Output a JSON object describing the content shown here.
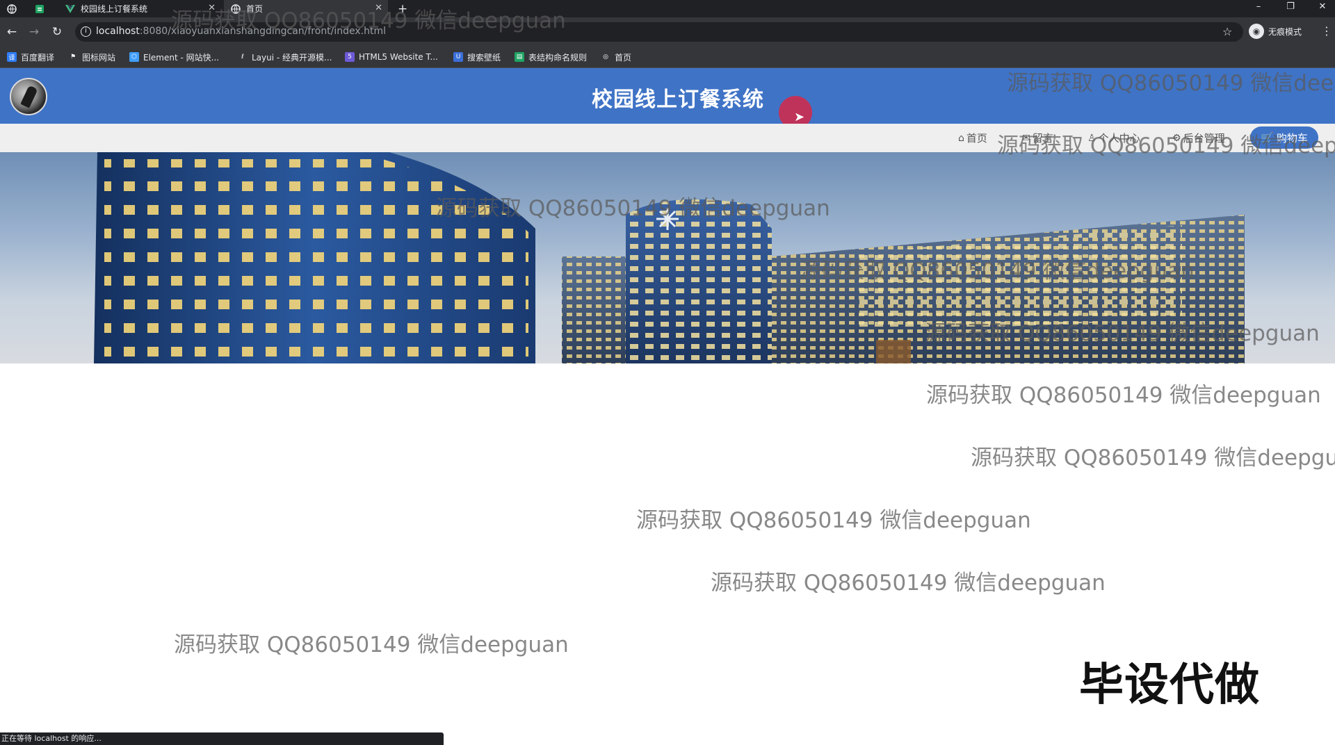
{
  "browser": {
    "tabs": [
      {
        "title": "",
        "icon": "globe-icon"
      },
      {
        "title": "",
        "icon": "green-square-icon"
      },
      {
        "title": "校园线上订餐系统",
        "icon": "vue-icon"
      },
      {
        "title": "首页",
        "icon": "globe-icon"
      }
    ],
    "new_tab": "+",
    "url_host": "localhost",
    "url_path": ":8080/xiaoyuanxianshangdingcan/front/index.html",
    "incognito_label": "无痕模式",
    "bookmarks": [
      {
        "label": "百度翻译",
        "color": "#2f7cf6"
      },
      {
        "label": "图标网站",
        "color": "#444444"
      },
      {
        "label": "Element - 网站快...",
        "color": "#409eff"
      },
      {
        "label": "Layui - 经典开源模...",
        "color": "#555555"
      },
      {
        "label": "HTML5 Website T...",
        "color": "#6b5bd6"
      },
      {
        "label": "搜索壁纸",
        "color": "#3b6fd8"
      },
      {
        "label": "表结构命名规则",
        "color": "#1fa463"
      },
      {
        "label": "首页",
        "color": "#555555"
      }
    ],
    "status_text": "正在等待 localhost 的响应..."
  },
  "header": {
    "title": "校园线上订餐系统",
    "brand_color": "#3f73c6"
  },
  "nav": {
    "home": "首页",
    "messages": "留言",
    "profile": "个人中心",
    "admin": "后台管理",
    "cart": "购物车"
  },
  "watermark_text": "源码获取 QQ86050149 微信deepguan",
  "promo_text": "毕设代做"
}
